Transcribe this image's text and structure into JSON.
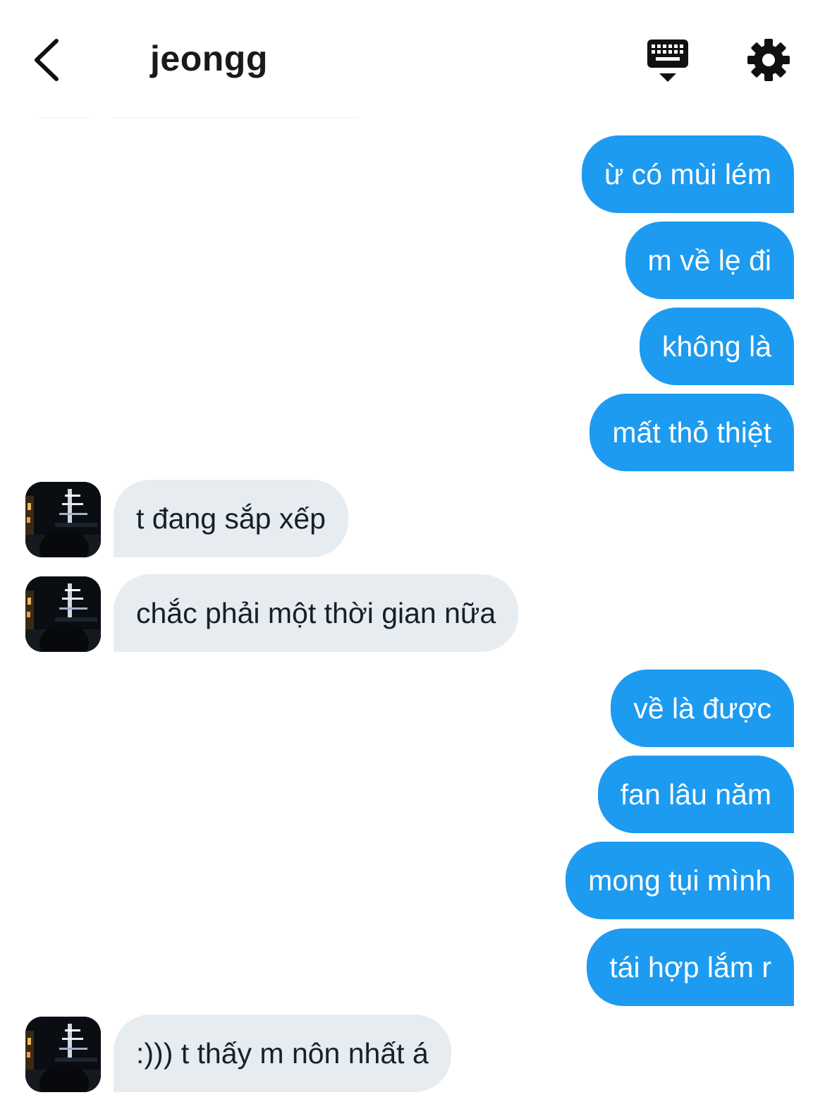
{
  "header": {
    "title": "jeongg",
    "icons": {
      "back": "chevron-left-icon",
      "keyboard": "keyboard-icon",
      "settings": "gear-icon"
    }
  },
  "messages": [
    {
      "direction": "out",
      "text": "ừ có mùi lém"
    },
    {
      "direction": "out",
      "text": "m về lẹ đi"
    },
    {
      "direction": "out",
      "text": "không là"
    },
    {
      "direction": "out",
      "text": "mất thỏ thiệt"
    },
    {
      "direction": "in",
      "text": "t đang sắp xếp"
    },
    {
      "direction": "in",
      "text": "chắc phải một thời gian nữa"
    },
    {
      "direction": "out",
      "text": "về là được"
    },
    {
      "direction": "out",
      "text": "fan lâu năm"
    },
    {
      "direction": "out",
      "text": "mong tụi mình"
    },
    {
      "direction": "out",
      "text": "tái hợp lắm r"
    },
    {
      "direction": "in",
      "text": ":))) t thấy m nôn nhất á"
    }
  ],
  "colors": {
    "outgoing_bubble": "#1d9bf0",
    "incoming_bubble": "#e7ecf0",
    "outgoing_text": "#ffffff",
    "incoming_text": "#17202a"
  }
}
